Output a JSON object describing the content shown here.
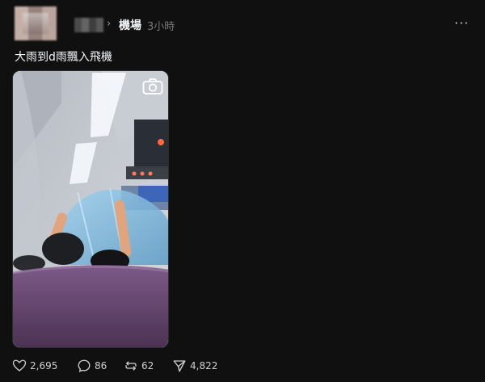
{
  "post": {
    "community": "機場",
    "time": "3小時",
    "caption": "大雨到d雨飄入飛機",
    "more_label": "···"
  },
  "media": {
    "camera_icon": "camera-icon"
  },
  "actions": {
    "likes": "2,695",
    "comments": "86",
    "reposts": "62",
    "shares": "4,822"
  },
  "colors": {
    "background": "#101010",
    "text": "#f3f5f7",
    "muted": "#777777"
  }
}
